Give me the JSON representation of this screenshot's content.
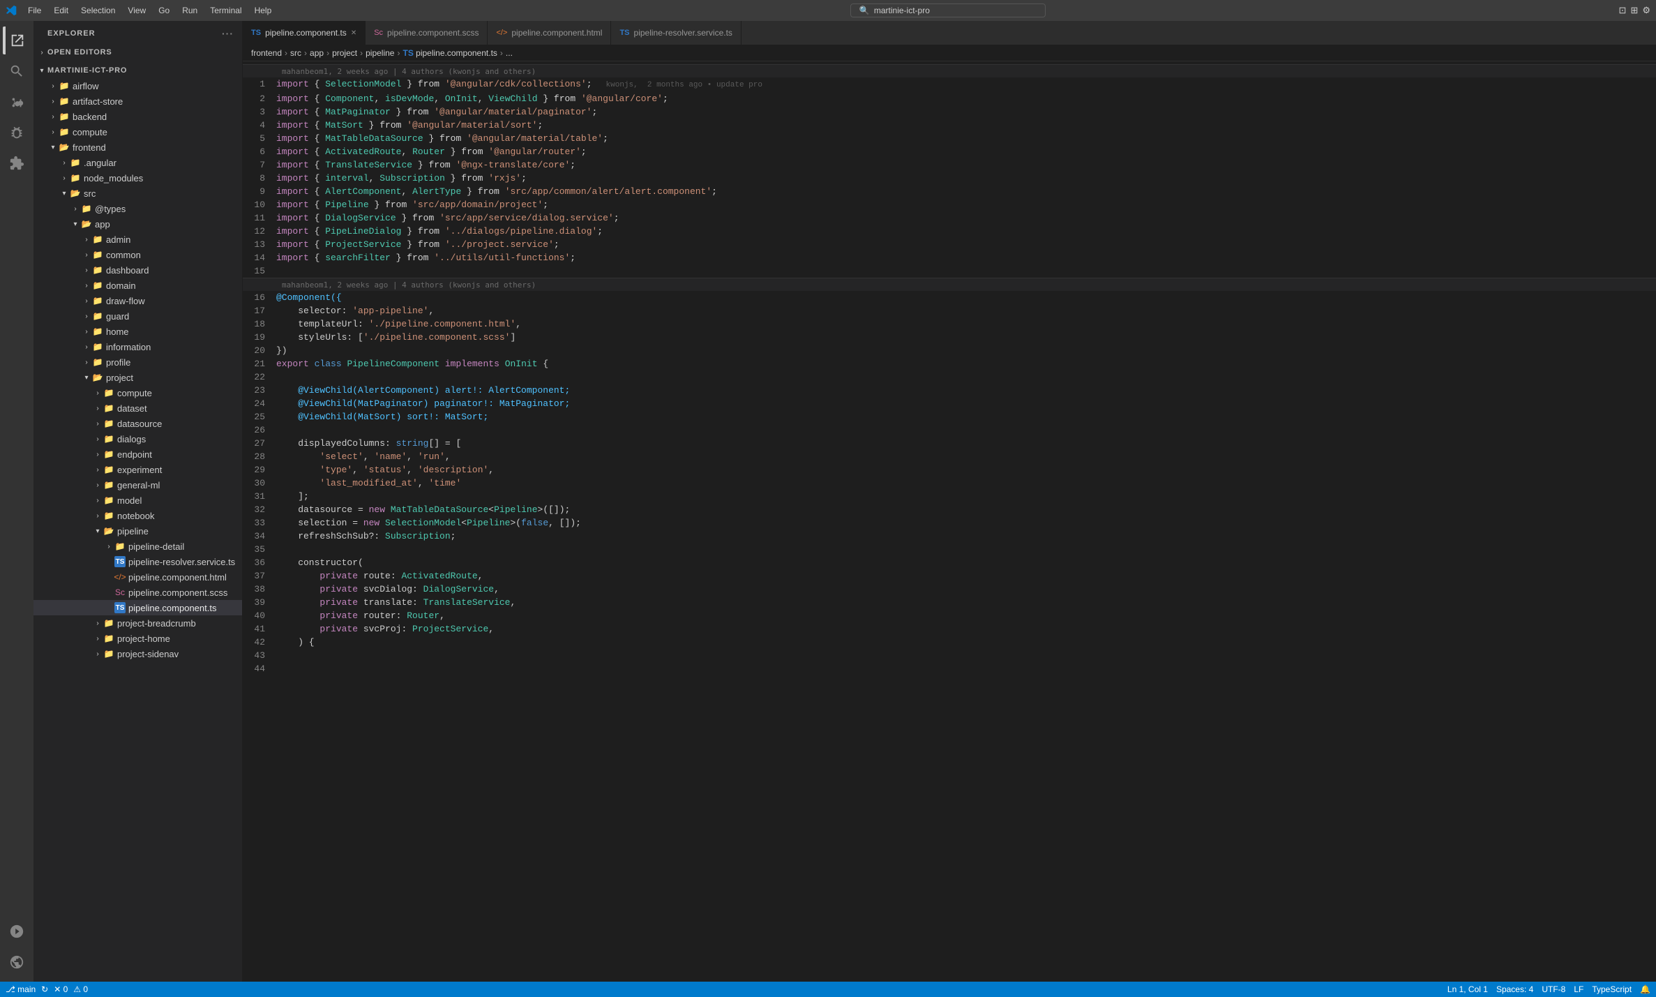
{
  "titlebar": {
    "menu": [
      "File",
      "Edit",
      "Selection",
      "View",
      "Go",
      "Run",
      "Terminal",
      "Help"
    ],
    "search_placeholder": "martinie-ict-pro",
    "app_name": "VS Code"
  },
  "tabs": [
    {
      "id": "tab-ts",
      "label": "pipeline.component.ts",
      "icon": "ts",
      "active": true,
      "closable": true
    },
    {
      "id": "tab-scss",
      "label": "pipeline.component.scss",
      "icon": "scss",
      "active": false,
      "closable": false
    },
    {
      "id": "tab-html",
      "label": "pipeline.component.html",
      "icon": "html",
      "active": false,
      "closable": false
    },
    {
      "id": "tab-resolver",
      "label": "pipeline-resolver.service.ts",
      "icon": "ts",
      "active": false,
      "closable": false
    }
  ],
  "breadcrumb": {
    "parts": [
      "frontend",
      "src",
      "app",
      "project",
      "pipeline",
      "TS pipeline.component.ts",
      "..."
    ]
  },
  "sidebar": {
    "title": "EXPLORER",
    "sections": [
      {
        "id": "open-editors",
        "label": "OPEN EDITORS",
        "collapsed": true,
        "items": []
      },
      {
        "id": "martinie-ict-pro",
        "label": "MARTINIE-ICT-PRO",
        "collapsed": false,
        "items": [
          {
            "id": "airflow",
            "label": "airflow",
            "type": "folder",
            "depth": 1
          },
          {
            "id": "artifact-store",
            "label": "artifact-store",
            "type": "folder",
            "depth": 1
          },
          {
            "id": "backend",
            "label": "backend",
            "type": "folder",
            "depth": 1
          },
          {
            "id": "compute",
            "label": "compute",
            "type": "folder",
            "depth": 1
          },
          {
            "id": "frontend",
            "label": "frontend",
            "type": "folder-open",
            "depth": 1
          },
          {
            "id": "angular",
            "label": ".angular",
            "type": "folder",
            "depth": 2
          },
          {
            "id": "node_modules",
            "label": "node_modules",
            "type": "folder",
            "depth": 2
          },
          {
            "id": "src",
            "label": "src",
            "type": "folder-open",
            "depth": 2
          },
          {
            "id": "types",
            "label": "@types",
            "type": "folder",
            "depth": 3
          },
          {
            "id": "app",
            "label": "app",
            "type": "folder-open",
            "depth": 3
          },
          {
            "id": "admin",
            "label": "admin",
            "type": "folder",
            "depth": 4
          },
          {
            "id": "common",
            "label": "common",
            "type": "folder",
            "depth": 4
          },
          {
            "id": "dashboard",
            "label": "dashboard",
            "type": "folder",
            "depth": 4
          },
          {
            "id": "domain",
            "label": "domain",
            "type": "folder",
            "depth": 4
          },
          {
            "id": "draw-flow",
            "label": "draw-flow",
            "type": "folder",
            "depth": 4
          },
          {
            "id": "guard",
            "label": "guard",
            "type": "folder",
            "depth": 4
          },
          {
            "id": "home",
            "label": "home",
            "type": "folder",
            "depth": 4
          },
          {
            "id": "information",
            "label": "information",
            "type": "folder",
            "depth": 4
          },
          {
            "id": "profile",
            "label": "profile",
            "type": "folder",
            "depth": 4
          },
          {
            "id": "project",
            "label": "project",
            "type": "folder-open",
            "depth": 4
          },
          {
            "id": "compute2",
            "label": "compute",
            "type": "folder",
            "depth": 5
          },
          {
            "id": "dataset",
            "label": "dataset",
            "type": "folder",
            "depth": 5
          },
          {
            "id": "datasource",
            "label": "datasource",
            "type": "folder",
            "depth": 5
          },
          {
            "id": "dialogs",
            "label": "dialogs",
            "type": "folder",
            "depth": 5
          },
          {
            "id": "endpoint",
            "label": "endpoint",
            "type": "folder",
            "depth": 5
          },
          {
            "id": "experiment",
            "label": "experiment",
            "type": "folder",
            "depth": 5
          },
          {
            "id": "general-ml",
            "label": "general-ml",
            "type": "folder",
            "depth": 5
          },
          {
            "id": "model",
            "label": "model",
            "type": "folder",
            "depth": 5
          },
          {
            "id": "notebook",
            "label": "notebook",
            "type": "folder",
            "depth": 5
          },
          {
            "id": "pipeline",
            "label": "pipeline",
            "type": "folder-open",
            "depth": 5
          },
          {
            "id": "pipeline-detail",
            "label": "pipeline-detail",
            "type": "folder",
            "depth": 6
          },
          {
            "id": "pipeline-resolver-service-ts",
            "label": "pipeline-resolver.service.ts",
            "type": "ts",
            "depth": 6
          },
          {
            "id": "pipeline-component-html",
            "label": "pipeline.component.html",
            "type": "html",
            "depth": 6
          },
          {
            "id": "pipeline-component-scss",
            "label": "pipeline.component.scss",
            "type": "scss",
            "depth": 6
          },
          {
            "id": "pipeline-component-ts",
            "label": "pipeline.component.ts",
            "type": "ts",
            "depth": 6,
            "active": true
          },
          {
            "id": "project-breadcrumb",
            "label": "project-breadcrumb",
            "type": "folder",
            "depth": 5
          },
          {
            "id": "project-home",
            "label": "project-home",
            "type": "folder",
            "depth": 5
          },
          {
            "id": "project-sidenav",
            "label": "project-sidenav",
            "type": "folder",
            "depth": 5
          }
        ]
      }
    ]
  },
  "blame_headers": {
    "line1_blame": "mahanbeom1, 2 weeks ago | 4 authors (kwonjs and others)",
    "line16_blame": "mahanbeom1, 2 weeks ago | 4 authors (kwonjs and others)",
    "line1_ghost": "kwonjs,  2 months ago • update pro"
  },
  "code_lines": [
    {
      "num": 1,
      "blame": "",
      "text": "import { SelectionModel } from '@angular/cdk/collections';"
    },
    {
      "num": 2,
      "blame": "",
      "text": "import { Component, isDevMode, OnInit, ViewChild } from '@angular/core';"
    },
    {
      "num": 3,
      "blame": "",
      "text": "import { MatPaginator } from '@angular/material/paginator';"
    },
    {
      "num": 4,
      "blame": "",
      "text": "import { MatSort } from '@angular/material/sort';"
    },
    {
      "num": 5,
      "blame": "",
      "text": "import { MatTableDataSource } from '@angular/material/table';"
    },
    {
      "num": 6,
      "blame": "",
      "text": "import { ActivatedRoute, Router } from '@angular/router';"
    },
    {
      "num": 7,
      "blame": "",
      "text": "import { TranslateService } from '@ngx-translate/core';"
    },
    {
      "num": 8,
      "blame": "",
      "text": "import { interval, Subscription } from 'rxjs';"
    },
    {
      "num": 9,
      "blame": "",
      "text": "import { AlertComponent, AlertType } from 'src/app/common/alert/alert.component';"
    },
    {
      "num": 10,
      "blame": "",
      "text": "import { Pipeline } from 'src/app/domain/project';"
    },
    {
      "num": 11,
      "blame": "",
      "text": "import { DialogService } from 'src/app/service/dialog.service';"
    },
    {
      "num": 12,
      "blame": "",
      "text": "import { PipeLineDialog } from '../dialogs/pipeline.dialog';"
    },
    {
      "num": 13,
      "blame": "",
      "text": "import { ProjectService } from '../project.service';"
    },
    {
      "num": 14,
      "blame": "",
      "text": "import { searchFilter } from '../utils/util-functions';"
    },
    {
      "num": 15,
      "blame": "",
      "text": ""
    },
    {
      "num": 16,
      "blame": "",
      "text": "@Component({"
    },
    {
      "num": 17,
      "blame": "",
      "text": "    selector: 'app-pipeline',"
    },
    {
      "num": 18,
      "blame": "",
      "text": "    templateUrl: './pipeline.component.html',"
    },
    {
      "num": 19,
      "blame": "",
      "text": "    styleUrls: ['./pipeline.component.scss']"
    },
    {
      "num": 20,
      "blame": "",
      "text": "})"
    },
    {
      "num": 21,
      "blame": "",
      "text": "export class PipelineComponent implements OnInit {"
    },
    {
      "num": 22,
      "blame": "",
      "text": ""
    },
    {
      "num": 23,
      "blame": "",
      "text": "    @ViewChild(AlertComponent) alert!: AlertComponent;"
    },
    {
      "num": 24,
      "blame": "",
      "text": "    @ViewChild(MatPaginator) paginator!: MatPaginator;"
    },
    {
      "num": 25,
      "blame": "",
      "text": "    @ViewChild(MatSort) sort!: MatSort;"
    },
    {
      "num": 26,
      "blame": "",
      "text": ""
    },
    {
      "num": 27,
      "blame": "",
      "text": "    displayedColumns: string[] = ["
    },
    {
      "num": 28,
      "blame": "",
      "text": "        'select', 'name', 'run',"
    },
    {
      "num": 29,
      "blame": "",
      "text": "        'type', 'status', 'description',"
    },
    {
      "num": 30,
      "blame": "",
      "text": "        'last_modified_at', 'time'"
    },
    {
      "num": 31,
      "blame": "",
      "text": "    ];"
    },
    {
      "num": 32,
      "blame": "",
      "text": "    datasource = new MatTableDataSource<Pipeline>([]);"
    },
    {
      "num": 33,
      "blame": "",
      "text": "    selection = new SelectionModel<Pipeline>(false, []);"
    },
    {
      "num": 34,
      "blame": "",
      "text": "    refreshSchSub?: Subscription;"
    },
    {
      "num": 35,
      "blame": "",
      "text": ""
    },
    {
      "num": 36,
      "blame": "",
      "text": "    constructor("
    },
    {
      "num": 37,
      "blame": "",
      "text": "        private route: ActivatedRoute,"
    },
    {
      "num": 38,
      "blame": "",
      "text": "        private svcDialog: DialogService,"
    },
    {
      "num": 39,
      "blame": "",
      "text": "        private translate: TranslateService,"
    },
    {
      "num": 40,
      "blame": "",
      "text": "        private router: Router,"
    },
    {
      "num": 41,
      "blame": "",
      "text": "        private svcProj: ProjectService,"
    },
    {
      "num": 42,
      "blame": "",
      "text": "    ) {"
    },
    {
      "num": 43,
      "blame": "",
      "text": ""
    },
    {
      "num": 44,
      "blame": "",
      "text": "    "
    }
  ],
  "status_bar": {
    "branch": "main",
    "errors": "0",
    "warnings": "0",
    "encoding": "UTF-8",
    "line_ending": "LF",
    "language": "TypeScript",
    "spaces": "Spaces: 4",
    "position": "Ln 1, Col 1"
  }
}
